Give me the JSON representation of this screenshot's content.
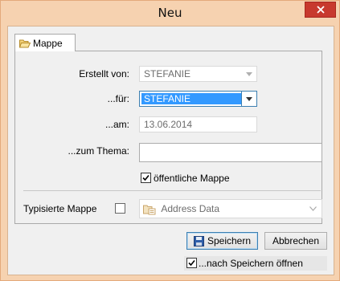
{
  "window": {
    "title": "Neu",
    "close_icon": "close-icon"
  },
  "tab": {
    "label": "Mappe",
    "icon": "folder-icon"
  },
  "form": {
    "created_by": {
      "label": "Erstellt von:",
      "value": "STEFANIE"
    },
    "for": {
      "label": "...für:",
      "value": "STEFANIE"
    },
    "on": {
      "label": "...am:",
      "value": "13.06.2014"
    },
    "topic": {
      "label": "...zum Thema:",
      "value": ""
    },
    "public_folder": {
      "label": "öffentliche Mappe",
      "checked": true
    }
  },
  "typed_folder": {
    "label": "Typisierte Mappe",
    "checked": false,
    "combo_value": "Address Data",
    "combo_icon": "address-data-icon"
  },
  "buttons": {
    "save": "Speichern",
    "save_icon": "floppy-disk-icon",
    "cancel": "Abbrechen"
  },
  "open_after_save": {
    "label": "...nach Speichern öffnen",
    "checked": true
  },
  "colors": {
    "frame": "#f6d2b0",
    "close": "#c7392e",
    "selection": "#3399ff",
    "focus_border": "#3c7fb1"
  }
}
